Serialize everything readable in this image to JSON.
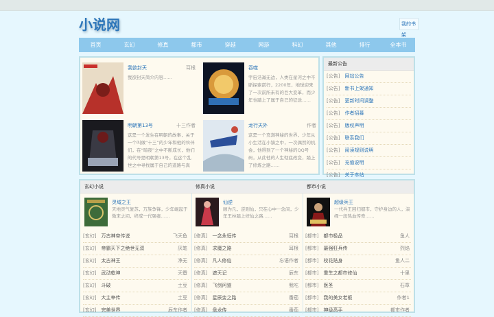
{
  "site": {
    "logo": "小说网",
    "bookshelf": "我的书架"
  },
  "nav": [
    "首页",
    "玄幻",
    "修真",
    "都市",
    "穿越",
    "网游",
    "科幻",
    "其他",
    "排行",
    "全本书"
  ],
  "featured": [
    {
      "title": "我欲封天",
      "author": "耳根",
      "desc": "我欲封天简介内容……"
    },
    {
      "title": "吞噬",
      "author": "",
      "desc": "宇宙浩瀚无边，人类在星河之中不断探索前行，2200年，地球迎来了一次前所未有的巨大变革，而少年也踏上了属于自己的征途……"
    },
    {
      "title": "明朝第13号",
      "author": "十三作者",
      "desc": "这是一个发生在明朝的故事，关于一个叫做“十三”的少年和他的伙伴们，在“暗夜”之中不断成长，他们的代号是明朝第13号，在这个乱世之中寻找属于自己的道路与真相……"
    },
    {
      "title": "龙行天外",
      "author": "作者",
      "desc": "这是一个充满神秘的世界，少年从小生活在小镇之中，一次偶然的机会，他得到了一个神秘的QQ号码，从此他的人生彻底改变，踏上了修炼之路……"
    }
  ],
  "notice": {
    "heading": "最新公告",
    "items": [
      {
        "tag": "[公告]",
        "title": "网站公告"
      },
      {
        "tag": "[公告]",
        "title": "新书上架通知"
      },
      {
        "tag": "[公告]",
        "title": "更新时间调整"
      },
      {
        "tag": "[公告]",
        "title": "作者招募"
      },
      {
        "tag": "[公告]",
        "title": "版权声明"
      },
      {
        "tag": "[公告]",
        "title": "联系我们"
      },
      {
        "tag": "[公告]",
        "title": "阅读规则说明"
      },
      {
        "tag": "[公告]",
        "title": "充值说明"
      },
      {
        "tag": "[公告]",
        "title": "关于本站"
      }
    ]
  },
  "columns": [
    {
      "heading": "玄幻小说",
      "top": {
        "title": "灵域之王",
        "desc": "天地灵气复苏，万族争锋，少年崛起于微末之间，终成一代强者……"
      },
      "rows": [
        {
          "tag": "[玄幻]",
          "title": "万古神帝传说",
          "author": "飞天鱼"
        },
        {
          "tag": "[玄幻]",
          "title": "帝霸天下之绝世无双",
          "author": "厌笔"
        },
        {
          "tag": "[玄幻]",
          "title": "太古神王",
          "author": "净无"
        },
        {
          "tag": "[玄幻]",
          "title": "武动乾坤",
          "author": "天蚕"
        },
        {
          "tag": "[玄幻]",
          "title": "斗破",
          "author": "土豆"
        },
        {
          "tag": "[玄幻]",
          "title": "大主宰传",
          "author": "土豆"
        },
        {
          "tag": "[玄幻]",
          "title": "完美世界",
          "author": "辰东作者"
        }
      ]
    },
    {
      "heading": "修真小说",
      "top": {
        "title": "仙逆",
        "desc": "顺为凡，逆则仙，只在心中一念间，少年王林踏上修仙之路……"
      },
      "rows": [
        {
          "tag": "[修真]",
          "title": "一念永恒传",
          "author": "耳根"
        },
        {
          "tag": "[修真]",
          "title": "求魔之路",
          "author": "耳根"
        },
        {
          "tag": "[修真]",
          "title": "凡人修仙",
          "author": "忘语作者"
        },
        {
          "tag": "[修真]",
          "title": "遮天记",
          "author": "辰东"
        },
        {
          "tag": "[修真]",
          "title": "飞剑问道",
          "author": "我吃"
        },
        {
          "tag": "[修真]",
          "title": "星辰变之路",
          "author": "番茄"
        },
        {
          "tag": "[修真]",
          "title": "盘龙传",
          "author": "番茄"
        }
      ]
    },
    {
      "heading": "都市小说",
      "top": {
        "title": "超级兵王",
        "desc": "一代兵王回归都市，守护身边的人，演绎一段热血传奇……"
      },
      "rows": [
        {
          "tag": "[都市]",
          "title": "都市极品",
          "author": "鱼人"
        },
        {
          "tag": "[都市]",
          "title": "最强狂兵传",
          "author": "烈焰"
        },
        {
          "tag": "[都市]",
          "title": "校花贴身",
          "author": "鱼人二"
        },
        {
          "tag": "[都市]",
          "title": "重生之都市修仙",
          "author": "十里"
        },
        {
          "tag": "[都市]",
          "title": "医圣",
          "author": "石章"
        },
        {
          "tag": "[都市]",
          "title": "我的美女老板",
          "author": "作者1"
        },
        {
          "tag": "[都市]",
          "title": "神级高手",
          "author": "都市作者"
        }
      ]
    }
  ]
}
